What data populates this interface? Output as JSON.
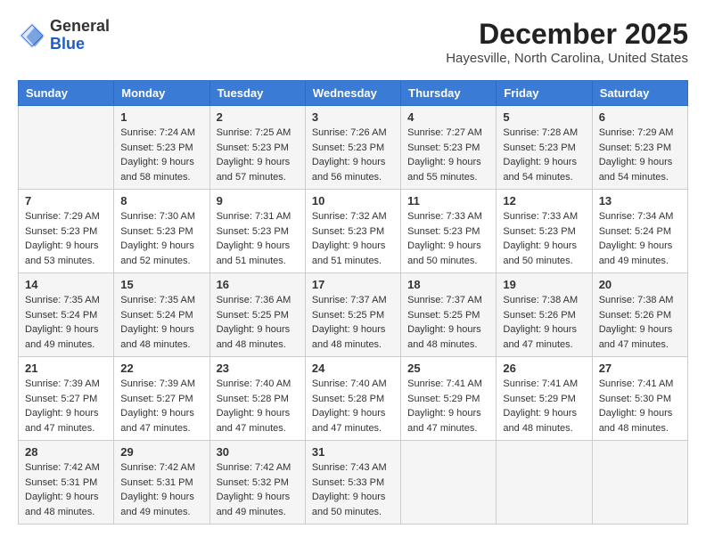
{
  "header": {
    "logo_general": "General",
    "logo_blue": "Blue",
    "month": "December 2025",
    "location": "Hayesville, North Carolina, United States"
  },
  "days_of_week": [
    "Sunday",
    "Monday",
    "Tuesday",
    "Wednesday",
    "Thursday",
    "Friday",
    "Saturday"
  ],
  "weeks": [
    [
      {
        "day": "",
        "info": ""
      },
      {
        "day": "1",
        "info": "Sunrise: 7:24 AM\nSunset: 5:23 PM\nDaylight: 9 hours\nand 58 minutes."
      },
      {
        "day": "2",
        "info": "Sunrise: 7:25 AM\nSunset: 5:23 PM\nDaylight: 9 hours\nand 57 minutes."
      },
      {
        "day": "3",
        "info": "Sunrise: 7:26 AM\nSunset: 5:23 PM\nDaylight: 9 hours\nand 56 minutes."
      },
      {
        "day": "4",
        "info": "Sunrise: 7:27 AM\nSunset: 5:23 PM\nDaylight: 9 hours\nand 55 minutes."
      },
      {
        "day": "5",
        "info": "Sunrise: 7:28 AM\nSunset: 5:23 PM\nDaylight: 9 hours\nand 54 minutes."
      },
      {
        "day": "6",
        "info": "Sunrise: 7:29 AM\nSunset: 5:23 PM\nDaylight: 9 hours\nand 54 minutes."
      }
    ],
    [
      {
        "day": "7",
        "info": "Sunrise: 7:29 AM\nSunset: 5:23 PM\nDaylight: 9 hours\nand 53 minutes."
      },
      {
        "day": "8",
        "info": "Sunrise: 7:30 AM\nSunset: 5:23 PM\nDaylight: 9 hours\nand 52 minutes."
      },
      {
        "day": "9",
        "info": "Sunrise: 7:31 AM\nSunset: 5:23 PM\nDaylight: 9 hours\nand 51 minutes."
      },
      {
        "day": "10",
        "info": "Sunrise: 7:32 AM\nSunset: 5:23 PM\nDaylight: 9 hours\nand 51 minutes."
      },
      {
        "day": "11",
        "info": "Sunrise: 7:33 AM\nSunset: 5:23 PM\nDaylight: 9 hours\nand 50 minutes."
      },
      {
        "day": "12",
        "info": "Sunrise: 7:33 AM\nSunset: 5:23 PM\nDaylight: 9 hours\nand 50 minutes."
      },
      {
        "day": "13",
        "info": "Sunrise: 7:34 AM\nSunset: 5:24 PM\nDaylight: 9 hours\nand 49 minutes."
      }
    ],
    [
      {
        "day": "14",
        "info": "Sunrise: 7:35 AM\nSunset: 5:24 PM\nDaylight: 9 hours\nand 49 minutes."
      },
      {
        "day": "15",
        "info": "Sunrise: 7:35 AM\nSunset: 5:24 PM\nDaylight: 9 hours\nand 48 minutes."
      },
      {
        "day": "16",
        "info": "Sunrise: 7:36 AM\nSunset: 5:25 PM\nDaylight: 9 hours\nand 48 minutes."
      },
      {
        "day": "17",
        "info": "Sunrise: 7:37 AM\nSunset: 5:25 PM\nDaylight: 9 hours\nand 48 minutes."
      },
      {
        "day": "18",
        "info": "Sunrise: 7:37 AM\nSunset: 5:25 PM\nDaylight: 9 hours\nand 48 minutes."
      },
      {
        "day": "19",
        "info": "Sunrise: 7:38 AM\nSunset: 5:26 PM\nDaylight: 9 hours\nand 47 minutes."
      },
      {
        "day": "20",
        "info": "Sunrise: 7:38 AM\nSunset: 5:26 PM\nDaylight: 9 hours\nand 47 minutes."
      }
    ],
    [
      {
        "day": "21",
        "info": "Sunrise: 7:39 AM\nSunset: 5:27 PM\nDaylight: 9 hours\nand 47 minutes."
      },
      {
        "day": "22",
        "info": "Sunrise: 7:39 AM\nSunset: 5:27 PM\nDaylight: 9 hours\nand 47 minutes."
      },
      {
        "day": "23",
        "info": "Sunrise: 7:40 AM\nSunset: 5:28 PM\nDaylight: 9 hours\nand 47 minutes."
      },
      {
        "day": "24",
        "info": "Sunrise: 7:40 AM\nSunset: 5:28 PM\nDaylight: 9 hours\nand 47 minutes."
      },
      {
        "day": "25",
        "info": "Sunrise: 7:41 AM\nSunset: 5:29 PM\nDaylight: 9 hours\nand 47 minutes."
      },
      {
        "day": "26",
        "info": "Sunrise: 7:41 AM\nSunset: 5:29 PM\nDaylight: 9 hours\nand 48 minutes."
      },
      {
        "day": "27",
        "info": "Sunrise: 7:41 AM\nSunset: 5:30 PM\nDaylight: 9 hours\nand 48 minutes."
      }
    ],
    [
      {
        "day": "28",
        "info": "Sunrise: 7:42 AM\nSunset: 5:31 PM\nDaylight: 9 hours\nand 48 minutes."
      },
      {
        "day": "29",
        "info": "Sunrise: 7:42 AM\nSunset: 5:31 PM\nDaylight: 9 hours\nand 49 minutes."
      },
      {
        "day": "30",
        "info": "Sunrise: 7:42 AM\nSunset: 5:32 PM\nDaylight: 9 hours\nand 49 minutes."
      },
      {
        "day": "31",
        "info": "Sunrise: 7:43 AM\nSunset: 5:33 PM\nDaylight: 9 hours\nand 50 minutes."
      },
      {
        "day": "",
        "info": ""
      },
      {
        "day": "",
        "info": ""
      },
      {
        "day": "",
        "info": ""
      }
    ]
  ]
}
